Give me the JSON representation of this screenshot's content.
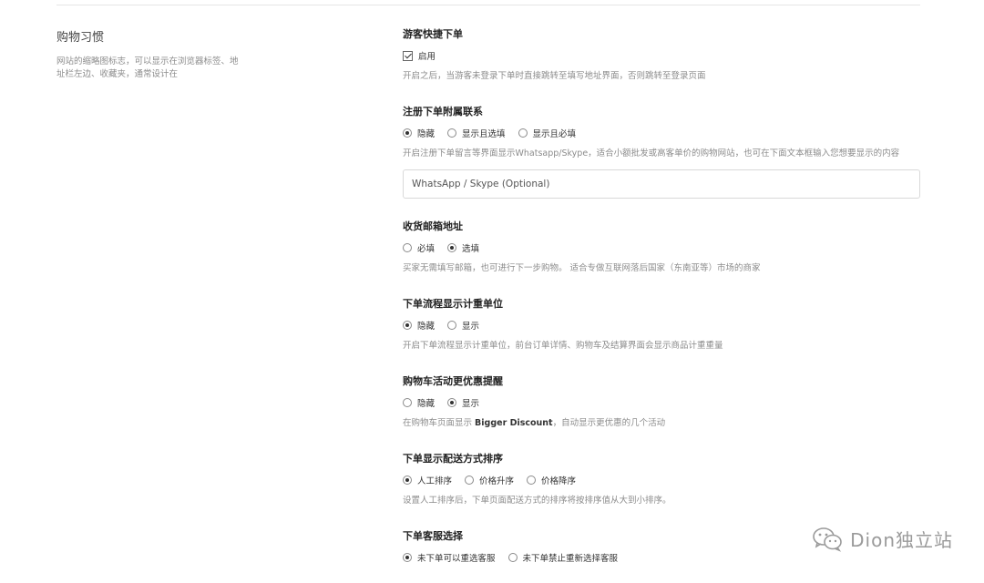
{
  "section": {
    "title": "购物习惯",
    "description": "网站的缩略图标志，可以显示在浏览器标签、地址栏左边、收藏夹，通常设计在"
  },
  "settings": [
    {
      "title": "游客快捷下单",
      "type": "checkbox",
      "options": [
        {
          "label": "启用",
          "checked": true
        }
      ],
      "help": "开启之后，当游客未登录下单时直接跳转至填写地址界面，否则跳转至登录页面"
    },
    {
      "title": "注册下单附属联系",
      "type": "radio",
      "options": [
        {
          "label": "隐藏",
          "checked": true
        },
        {
          "label": "显示且选填",
          "checked": false
        },
        {
          "label": "显示且必填",
          "checked": false
        }
      ],
      "help": "开启注册下单留言等界面显示Whatsapp/Skype，适合小额批发或高客单价的购物网站，也可在下面文本框输入您想要显示的内容",
      "input_placeholder": "WhatsApp / Skype (Optional)"
    },
    {
      "title": "收货邮箱地址",
      "type": "radio",
      "options": [
        {
          "label": "必填",
          "checked": false
        },
        {
          "label": "选填",
          "checked": true
        }
      ],
      "help": "买家无需填写邮箱，也可进行下一步购物。 适合专做互联网落后国家（东南亚等）市场的商家"
    },
    {
      "title": "下单流程显示计重单位",
      "type": "radio",
      "options": [
        {
          "label": "隐藏",
          "checked": true
        },
        {
          "label": "显示",
          "checked": false
        }
      ],
      "help": "开启下单流程显示计重单位，前台订单详情、购物车及结算界面会显示商品计重重量"
    },
    {
      "title": "购物车活动更优惠提醒",
      "type": "radio",
      "options": [
        {
          "label": "隐藏",
          "checked": false
        },
        {
          "label": "显示",
          "checked": true
        }
      ],
      "help_prefix": "在购物车页面显示 ",
      "help_bold": "Bigger Discount",
      "help_suffix": "，自动显示更优惠的几个活动"
    },
    {
      "title": "下单显示配送方式排序",
      "type": "radio",
      "options": [
        {
          "label": "人工排序",
          "checked": true
        },
        {
          "label": "价格升序",
          "checked": false
        },
        {
          "label": "价格降序",
          "checked": false
        }
      ],
      "help": "设置人工排序后，下单页面配送方式的排序将按排序值从大到小排序。"
    },
    {
      "title": "下单客服选择",
      "type": "radio",
      "options": [
        {
          "label": "未下单可以重选客服",
          "checked": true
        },
        {
          "label": "未下单禁止重新选择客服",
          "checked": false
        }
      ]
    }
  ],
  "watermark": {
    "text": "Dion独立站",
    "icon": "wechat-icon"
  }
}
